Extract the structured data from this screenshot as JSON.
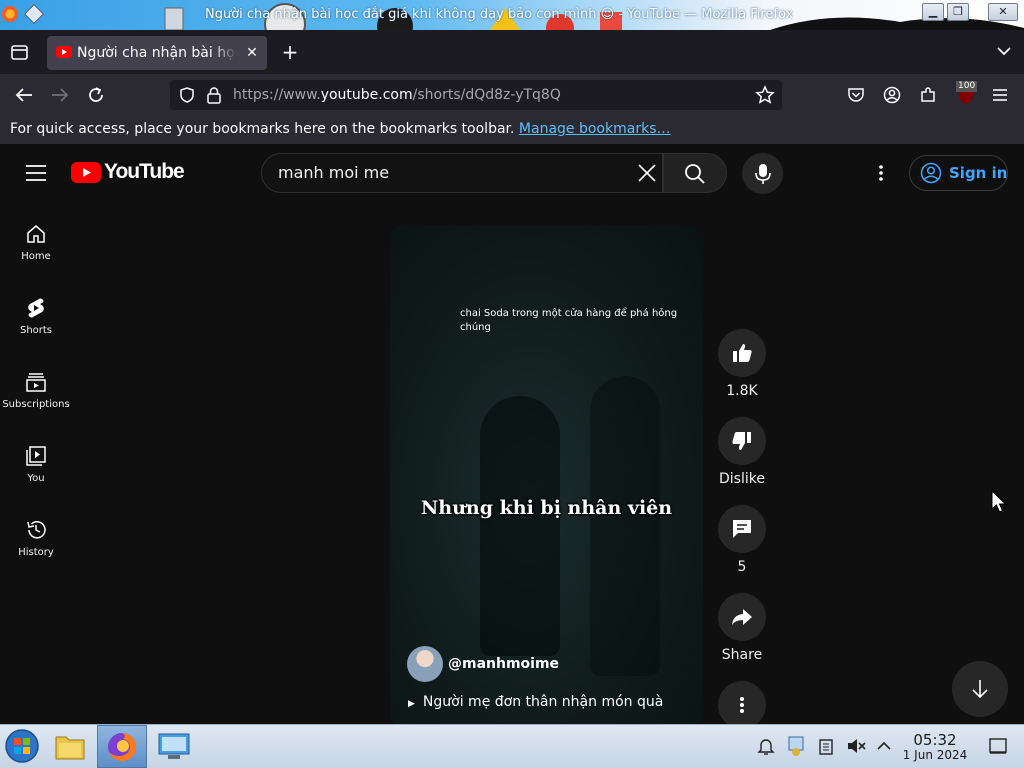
{
  "window": {
    "title": "Người cha nhận bài học đắt giá khi không dạy bảo con mình ☺ - YouTube — Mozilla Firefox"
  },
  "browser": {
    "tab_title": "Người cha nhận bài học đắt giá khi không dạy bảo con mình",
    "url_prefix": "https://www.",
    "url_domain": "youtube.com",
    "url_path": "/shorts/dQd8z-yTq8Q",
    "bookmarks_message": "For quick access, place your bookmarks here on the bookmarks toolbar.",
    "bookmarks_link": "Manage bookmarks…",
    "extension_badge": "100"
  },
  "youtube": {
    "logo_text": "YouTube",
    "search_value": "manh moi me",
    "signin_label": "Sign in",
    "sidebar": [
      {
        "label": "Home",
        "icon": "home-icon"
      },
      {
        "label": "Shorts",
        "icon": "shorts-icon"
      },
      {
        "label": "Subscriptions",
        "icon": "subscriptions-icon"
      },
      {
        "label": "You",
        "icon": "you-icon"
      },
      {
        "label": "History",
        "icon": "history-icon"
      }
    ],
    "short": {
      "caption_top": "chai Soda trong một cửa hàng để phá hỏng chúng",
      "caption_mid": "Nhưng khi bị nhân viên",
      "channel": "@manhmoime",
      "song": "Người mẹ đơn thân nhận món quà"
    },
    "actions": {
      "like_count": "1.8K",
      "dislike_label": "Dislike",
      "comment_count": "5",
      "share_label": "Share"
    }
  },
  "taskbar": {
    "time": "05:32",
    "date": "1 Jun 2024"
  },
  "colors": {
    "yt_background": "#0f0f0f",
    "yt_red": "#ff0000",
    "link_blue": "#3ea6ff",
    "firefox_tabbar": "#1c1b22",
    "firefox_toolbar": "#2b2a33"
  }
}
